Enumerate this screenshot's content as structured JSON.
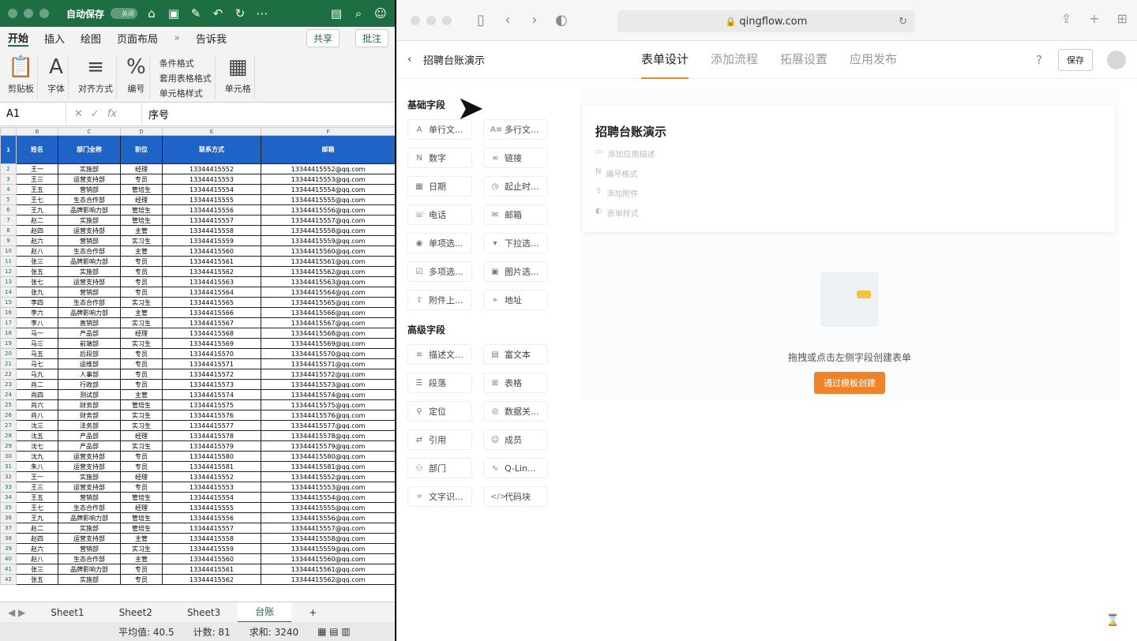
{
  "excel": {
    "autosave": "自动保存",
    "toggle": "关闭",
    "tabs": [
      "开始",
      "插入",
      "绘图",
      "页面布局",
      "»",
      "告诉我"
    ],
    "share": "共享",
    "comments": "批注",
    "ribbon": {
      "paste": "剪贴板",
      "font": "字体",
      "align": "对齐方式",
      "number": "编号",
      "conditional": "条件格式",
      "table": "套用表格格式",
      "cellstyle": "单元格样式",
      "cells": "单元格"
    },
    "cellref": "A1",
    "fx": "fx",
    "formula": "序号",
    "col_letters": [
      "B",
      "C",
      "D",
      "E",
      "F"
    ],
    "headers": [
      "姓名",
      "部门全称",
      "职位",
      "联系方式",
      "邮箱"
    ],
    "rows": [
      [
        "王一",
        "实施部",
        "经理",
        "13344415552",
        "13344415552@qq.com"
      ],
      [
        "王三",
        "运营支持部",
        "专员",
        "13344415553",
        "13344415553@qq.com"
      ],
      [
        "王五",
        "营销部",
        "管培生",
        "13344415554",
        "13344415554@qq.com"
      ],
      [
        "王七",
        "生态合作部",
        "经理",
        "13344415555",
        "13344415555@qq.com"
      ],
      [
        "王九",
        "品牌影响力部",
        "管培生",
        "13344415556",
        "13344415556@qq.com"
      ],
      [
        "赵二",
        "实施部",
        "管培生",
        "13344415557",
        "13344415557@qq.com"
      ],
      [
        "赵四",
        "运营支持部",
        "主管",
        "13344415558",
        "13344415558@qq.com"
      ],
      [
        "赵六",
        "营销部",
        "实习生",
        "13344415559",
        "13344415559@qq.com"
      ],
      [
        "赵八",
        "生态合作部",
        "主管",
        "13344415560",
        "13344415560@qq.com"
      ],
      [
        "张三",
        "品牌影响力部",
        "专员",
        "13344415561",
        "13344415561@qq.com"
      ],
      [
        "张五",
        "实施部",
        "专员",
        "13344415562",
        "13344415562@qq.com"
      ],
      [
        "张七",
        "运营支持部",
        "专员",
        "13344415563",
        "13344415563@qq.com"
      ],
      [
        "张九",
        "营销部",
        "专员",
        "13344415564",
        "13344415564@qq.com"
      ],
      [
        "李四",
        "生态合作部",
        "实习生",
        "13344415565",
        "13344415565@qq.com"
      ],
      [
        "李六",
        "品牌影响力部",
        "主管",
        "13344415566",
        "13344415566@qq.com"
      ],
      [
        "李八",
        "直销部",
        "实习生",
        "13344415567",
        "13344415567@qq.com"
      ],
      [
        "马一",
        "产品部",
        "经理",
        "13344415568",
        "13344415568@qq.com"
      ],
      [
        "马三",
        "前端部",
        "实习生",
        "13344415569",
        "13344415569@qq.com"
      ],
      [
        "马五",
        "后段部",
        "专员",
        "13344415570",
        "13344415570@qq.com"
      ],
      [
        "马七",
        "运维部",
        "专员",
        "13344415571",
        "13344415571@qq.com"
      ],
      [
        "马九",
        "人事部",
        "专员",
        "13344415572",
        "13344415572@qq.com"
      ],
      [
        "肖二",
        "行政部",
        "专员",
        "13344415573",
        "13344415573@qq.com"
      ],
      [
        "肖四",
        "测试部",
        "主管",
        "13344415574",
        "13344415574@qq.com"
      ],
      [
        "肖六",
        "财务部",
        "管培生",
        "13344415575",
        "13344415575@qq.com"
      ],
      [
        "肖八",
        "财务部",
        "实习生",
        "13344415576",
        "13344415576@qq.com"
      ],
      [
        "沈三",
        "法务部",
        "实习生",
        "13344415577",
        "13344415577@qq.com"
      ],
      [
        "沈五",
        "产品部",
        "经理",
        "13344415578",
        "13344415578@qq.com"
      ],
      [
        "沈七",
        "产品部",
        "实习生",
        "13344415579",
        "13344415579@qq.com"
      ],
      [
        "沈九",
        "运营支持部",
        "专员",
        "13344415580",
        "13344415580@qq.com"
      ],
      [
        "朱八",
        "运营支持部",
        "专员",
        "13344415581",
        "13344415581@qq.com"
      ],
      [
        "王一",
        "实施部",
        "经理",
        "13344415552",
        "13344415552@qq.com"
      ],
      [
        "王三",
        "运营支持部",
        "专员",
        "13344415553",
        "13344415553@qq.com"
      ],
      [
        "王五",
        "营销部",
        "管培生",
        "13344415554",
        "13344415554@qq.com"
      ],
      [
        "王七",
        "生态合作部",
        "经理",
        "13344415555",
        "13344415555@qq.com"
      ],
      [
        "王九",
        "品牌影响力部",
        "管培生",
        "13344415556",
        "13344415556@qq.com"
      ],
      [
        "赵二",
        "实施部",
        "管培生",
        "13344415557",
        "13344415557@qq.com"
      ],
      [
        "赵四",
        "运营支持部",
        "主管",
        "13344415558",
        "13344415558@qq.com"
      ],
      [
        "赵六",
        "营销部",
        "实习生",
        "13344415559",
        "13344415559@qq.com"
      ],
      [
        "赵八",
        "生态合作部",
        "主管",
        "13344415560",
        "13344415560@qq.com"
      ],
      [
        "张三",
        "品牌影响力部",
        "专员",
        "13344415561",
        "13344415561@qq.com"
      ],
      [
        "张五",
        "实施部",
        "专员",
        "13344415562",
        "13344415562@qq.com"
      ]
    ],
    "sheets": [
      "Sheet1",
      "Sheet2",
      "Sheet3",
      "台账"
    ],
    "active_sheet": "台账",
    "status": {
      "avg": "平均值: 40.5",
      "count": "计数: 81",
      "sum": "求和: 3240"
    }
  },
  "browser": {
    "url": "qingflow.com",
    "app_title": "招聘台账演示",
    "nav": [
      "表单设计",
      "添加流程",
      "拓展设置",
      "应用发布"
    ],
    "active_nav": "表单设计",
    "help": "?",
    "save": "保存",
    "basic_title": "基础字段",
    "basic": [
      {
        "icon": "A",
        "label": "单行文..."
      },
      {
        "icon": "A≡",
        "label": "多行文..."
      },
      {
        "icon": "N",
        "label": "数字"
      },
      {
        "icon": "∞",
        "label": "链接"
      },
      {
        "icon": "▦",
        "label": "日期"
      },
      {
        "icon": "◷",
        "label": "起止时..."
      },
      {
        "icon": "☏",
        "label": "电话"
      },
      {
        "icon": "✉",
        "label": "邮箱"
      },
      {
        "icon": "◉",
        "label": "单项选..."
      },
      {
        "icon": "▾",
        "label": "下拉选..."
      },
      {
        "icon": "☑",
        "label": "多项选..."
      },
      {
        "icon": "▣",
        "label": "图片选..."
      },
      {
        "icon": "⇪",
        "label": "附件上..."
      },
      {
        "icon": "⌖",
        "label": "地址"
      }
    ],
    "adv_title": "高级字段",
    "advanced": [
      {
        "icon": "≡",
        "label": "描述文..."
      },
      {
        "icon": "▤",
        "label": "富文本"
      },
      {
        "icon": "☰",
        "label": "段落"
      },
      {
        "icon": "⊞",
        "label": "表格"
      },
      {
        "icon": "⚲",
        "label": "定位"
      },
      {
        "icon": "◎",
        "label": "数据关..."
      },
      {
        "icon": "⇄",
        "label": "引用"
      },
      {
        "icon": "☺",
        "label": "成员"
      },
      {
        "icon": "⚇",
        "label": "部门"
      },
      {
        "icon": "∿",
        "label": "Q-Lin..."
      },
      {
        "icon": "⌗",
        "label": "文字识..."
      },
      {
        "icon": "</>",
        "label": "代码块"
      }
    ],
    "form_title": "招聘台账演示",
    "form_opts": [
      {
        "icon": "▭",
        "label": "添加应用描述"
      },
      {
        "icon": "N",
        "label": "编号格式"
      },
      {
        "icon": "⇪",
        "label": "添加附件"
      },
      {
        "icon": "◐",
        "label": "表单样式"
      }
    ],
    "empty_text": "拖拽或点击左侧字段创建表单",
    "template_btn": "通过模板创建"
  }
}
